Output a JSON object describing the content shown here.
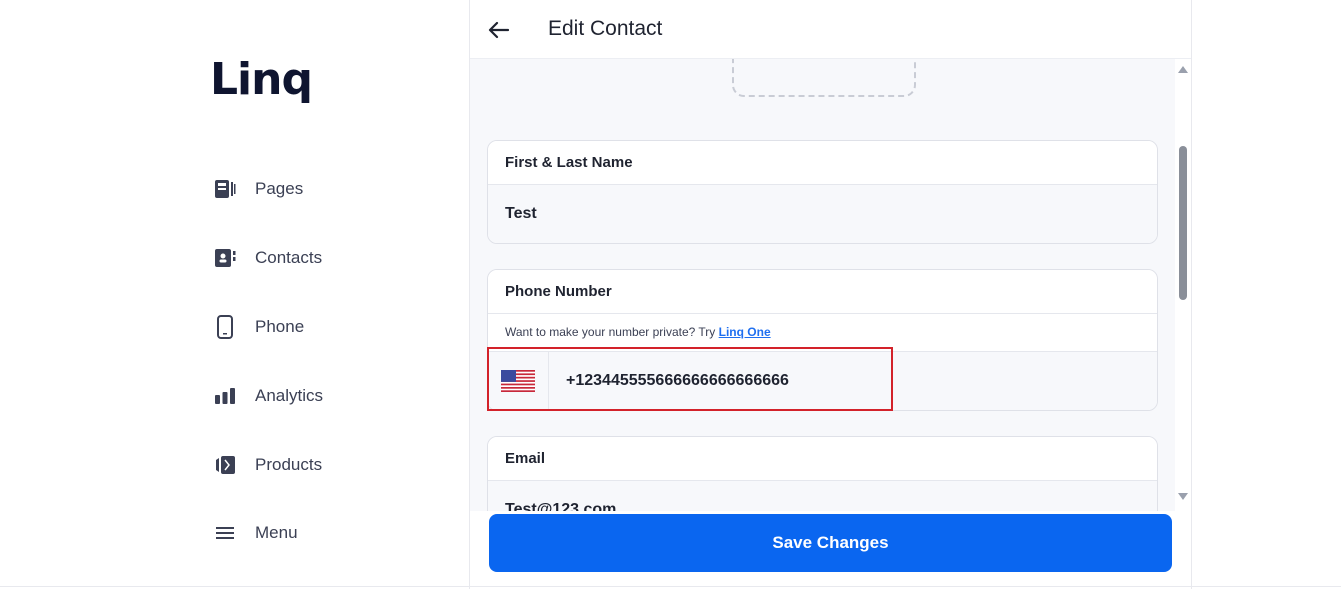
{
  "brand": {
    "logo_text": "Linq"
  },
  "sidebar": {
    "items": [
      {
        "label": "Pages",
        "icon": "pages-icon"
      },
      {
        "label": "Contacts",
        "icon": "contacts-icon"
      },
      {
        "label": "Phone",
        "icon": "phone-icon"
      },
      {
        "label": "Analytics",
        "icon": "analytics-icon"
      },
      {
        "label": "Products",
        "icon": "products-icon"
      },
      {
        "label": "Menu",
        "icon": "menu-icon"
      }
    ]
  },
  "header": {
    "title": "Edit Contact",
    "back_icon": "arrow-left-icon"
  },
  "form": {
    "name": {
      "label": "First & Last Name",
      "value": "Test"
    },
    "phone": {
      "label": "Phone Number",
      "hint_text": "Want to make your number private? Try ",
      "hint_link": "Linq One",
      "country_flag": "us-flag-icon",
      "value": "+123445555666666666666666"
    },
    "email": {
      "label": "Email",
      "value": "Test@123.com"
    }
  },
  "actions": {
    "save_label": "Save Changes"
  },
  "colors": {
    "accent": "#0a66f0",
    "highlight": "#d3222a",
    "link": "#1f6ff0"
  }
}
